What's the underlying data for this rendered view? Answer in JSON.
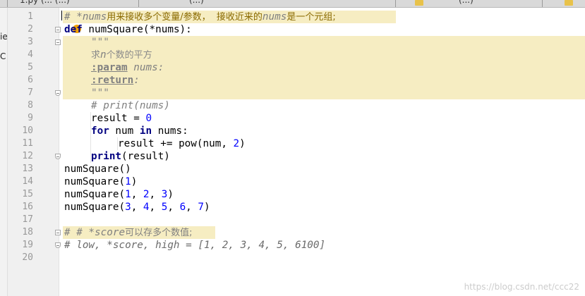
{
  "tabs": [
    {
      "label": "1.py (... (...)"
    },
    {
      "label": "(...)"
    },
    {
      "label": "(...)"
    }
  ],
  "side_labels": [
    "ie",
    "C"
  ],
  "lines": [
    {
      "no": "1"
    },
    {
      "no": "2"
    },
    {
      "no": "3"
    },
    {
      "no": "4"
    },
    {
      "no": "5"
    },
    {
      "no": "6"
    },
    {
      "no": "7"
    },
    {
      "no": "8"
    },
    {
      "no": "9"
    },
    {
      "no": "10"
    },
    {
      "no": "11"
    },
    {
      "no": "12"
    },
    {
      "no": "13"
    },
    {
      "no": "14"
    },
    {
      "no": "15"
    },
    {
      "no": "16"
    },
    {
      "no": "17"
    },
    {
      "no": "18"
    },
    {
      "no": "19"
    },
    {
      "no": "20"
    }
  ],
  "code": {
    "l1": {
      "hash": "# *",
      "var": "nums",
      "zh1": "用来接收多个变量/参数，  接收近来的",
      "var2": "nums",
      "zh2": "是一个元组;"
    },
    "l2": {
      "kw": "def",
      "rest": " numSquare(*nums):"
    },
    "l3": {
      "text": "\"\"\""
    },
    "l4": {
      "zh1": "求",
      "var": "n",
      "zh2": "个数的平方"
    },
    "l5": {
      "tag": ":param",
      "name": " nums:"
    },
    "l6": {
      "tag": ":return",
      "rest": ":"
    },
    "l7": {
      "text": "\"\"\""
    },
    "l8": {
      "text": "# print(nums)"
    },
    "l9": {
      "a": "result = ",
      "n": "0"
    },
    "l10": {
      "k1": "for",
      "a": " num ",
      "k2": "in",
      "b": " nums:"
    },
    "l11": {
      "a": "result += pow(num, ",
      "n": "2",
      "b": ")"
    },
    "l12": {
      "k": "print",
      "a": "(result)"
    },
    "l13": {
      "a": "numSquare()"
    },
    "l14": {
      "a": "numSquare(",
      "n": "1",
      "b": ")"
    },
    "l15": {
      "a": "numSquare(",
      "n1": "1",
      "s1": ", ",
      "n2": "2",
      "s2": ", ",
      "n3": "3",
      "b": ")"
    },
    "l16": {
      "a": "numSquare(",
      "n1": "3",
      "s1": ", ",
      "n2": "4",
      "s2": ", ",
      "n3": "5",
      "s3": ", ",
      "n4": "6",
      "s4": ", ",
      "n5": "7",
      "b": ")"
    },
    "l18": {
      "hash": "# # *",
      "var": "score",
      "zh": "可以存多个数值;"
    },
    "l19": {
      "text": "# low, *score, high = [1, 2, 3, 4, 5, 6100]"
    }
  },
  "watermark": "https://blog.csdn.net/ccc22",
  "colors": {
    "highlight": "#f6edc2",
    "keyword": "#000080",
    "number": "#0000ff",
    "comment": "#808080"
  }
}
